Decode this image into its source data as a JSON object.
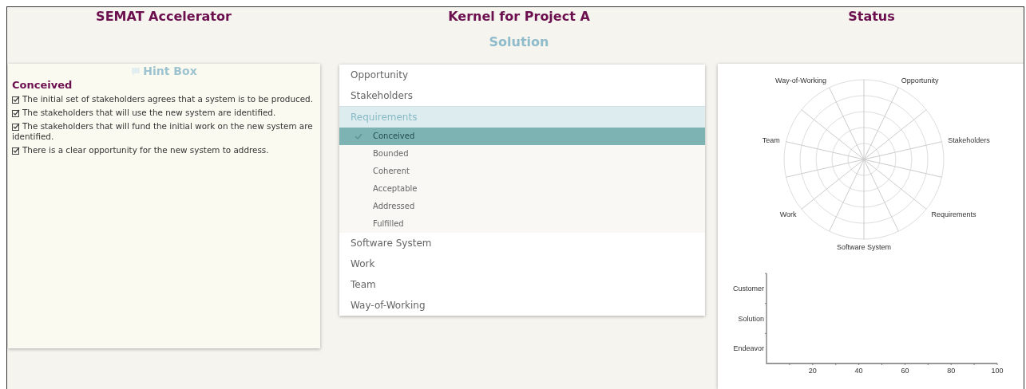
{
  "hint_panel": {
    "title": "SEMAT Accelerator",
    "caption": "Hint Box",
    "state_name": "Conceived",
    "checklist": [
      {
        "text": "The initial set of stakeholders agrees that a system is to be produced.",
        "checked": true
      },
      {
        "text": "The stakeholders that will use the new system are identified.",
        "checked": true
      },
      {
        "text": "The stakeholders that will fund the initial work on the new system are identified.",
        "checked": true
      },
      {
        "text": "There is a clear opportunity for the new system to address.",
        "checked": true
      }
    ]
  },
  "kernel_panel": {
    "title": "Kernel for Project A",
    "subtitle": "Solution",
    "alphas": [
      {
        "label": "Opportunity",
        "expanded": false
      },
      {
        "label": "Stakeholders",
        "expanded": false
      },
      {
        "label": "Requirements",
        "expanded": true,
        "children": [
          {
            "label": "Conceived",
            "selected": true
          },
          {
            "label": "Bounded",
            "selected": false
          },
          {
            "label": "Coherent",
            "selected": false
          },
          {
            "label": "Acceptable",
            "selected": false
          },
          {
            "label": "Addressed",
            "selected": false
          },
          {
            "label": "Fulfilled",
            "selected": false
          }
        ]
      },
      {
        "label": "Software System",
        "expanded": false
      },
      {
        "label": "Work",
        "expanded": false
      },
      {
        "label": "Team",
        "expanded": false
      },
      {
        "label": "Way-of-Working",
        "expanded": false
      }
    ]
  },
  "status_panel": {
    "title": "Status",
    "radar": {
      "axes": [
        "Opportunity",
        "Stakeholders",
        "Requirements",
        "Software System",
        "Work",
        "Team",
        "Way-of-Working"
      ]
    },
    "progress": {
      "chart_data": {
        "type": "bar",
        "orientation": "horizontal",
        "categories": [
          "Customer",
          "Solution",
          "Endeavor"
        ],
        "values": [
          null,
          null,
          null
        ],
        "xlim": [
          0,
          100
        ],
        "xticks": [
          20,
          40,
          60,
          80,
          100
        ]
      }
    }
  }
}
